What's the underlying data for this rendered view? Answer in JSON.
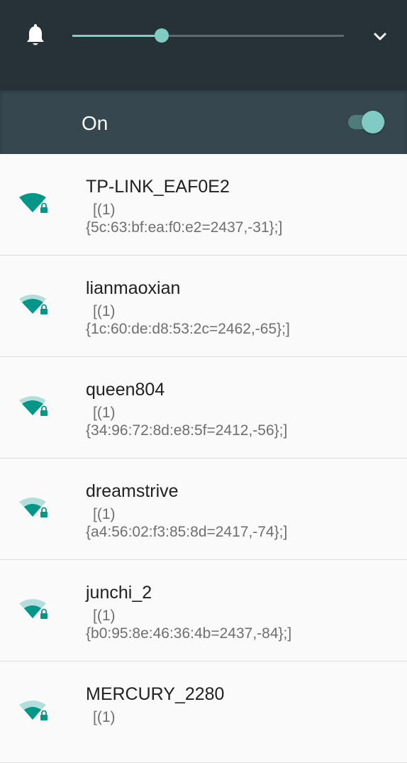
{
  "header": {
    "slider_level": 0.33
  },
  "wifi_toggle": {
    "label": "On",
    "state": "on"
  },
  "colors": {
    "accent": "#80cbc4",
    "icon_teal": "#009688",
    "icon_weak": "#b2dfdb",
    "header_bg": "#263238",
    "toggle_bar_bg": "#37474f"
  },
  "networks": [
    {
      "ssid": "TP-LINK_EAF0E2",
      "line1": "[(1)",
      "line2": "{5c:63:bf:ea:f0:e2=2437,-31};]",
      "signal_bars": 4,
      "secured": true
    },
    {
      "ssid": "lianmaoxian",
      "line1": "[(1)",
      "line2": "{1c:60:de:d8:53:2c=2462,-65};]",
      "signal_bars": 3,
      "secured": true
    },
    {
      "ssid": "queen804",
      "line1": "[(1)",
      "line2": "{34:96:72:8d:e8:5f=2412,-56};]",
      "signal_bars": 3,
      "secured": true
    },
    {
      "ssid": "dreamstrive",
      "line1": "[(1)",
      "line2": "{a4:56:02:f3:85:8d=2417,-74};]",
      "signal_bars": 2,
      "secured": true
    },
    {
      "ssid": "junchi_2",
      "line1": "[(1)",
      "line2": "{b0:95:8e:46:36:4b=2437,-84};]",
      "signal_bars": 2,
      "secured": true
    },
    {
      "ssid": "MERCURY_2280",
      "line1": "[(1)",
      "line2": "",
      "signal_bars": 2,
      "secured": true
    }
  ]
}
